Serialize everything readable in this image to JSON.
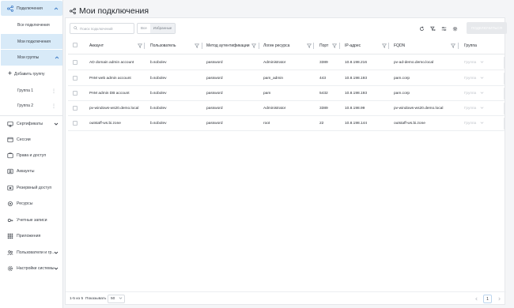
{
  "sidebar": {
    "connections_label": "Подключения",
    "all_connections": "Все подключения",
    "my_connections": "Мои подключения",
    "my_groups": "Мои группы",
    "add_group": "Добавить группу",
    "groups": [
      {
        "label": "Группа 1"
      },
      {
        "label": "Группа 2"
      }
    ],
    "items": [
      {
        "label": "Сертификаты",
        "icon": "certificate-icon",
        "has_chevron": true
      },
      {
        "label": "Сессии",
        "icon": "sessions-icon",
        "has_chevron": false
      },
      {
        "label": "Права и доступ",
        "icon": "rights-icon",
        "has_chevron": false
      },
      {
        "label": "Аккаунты",
        "icon": "accounts-icon",
        "has_chevron": false
      },
      {
        "label": "Резервный доступ",
        "icon": "backup-access-icon",
        "has_chevron": false
      },
      {
        "label": "Ресурсы",
        "icon": "resources-icon",
        "has_chevron": false
      },
      {
        "label": "Учетные записи",
        "icon": "credentials-icon",
        "has_chevron": false
      },
      {
        "label": "Приложения",
        "icon": "apps-icon",
        "has_chevron": false
      },
      {
        "label": "Пользователи и гр...",
        "icon": "users-icon",
        "has_chevron": true
      },
      {
        "label": "Настройки системы",
        "icon": "system-settings-icon",
        "has_chevron": true
      }
    ]
  },
  "header": {
    "title": "Мои подключения"
  },
  "toolbar": {
    "search_placeholder": "Поиск подключений",
    "filter_all": "Все",
    "filter_favorites": "Избранные",
    "create_label": "ПОДКЛЮЧИТЬСЯ"
  },
  "table": {
    "columns": [
      "Аккаунт",
      "Пользователь",
      "Метод аутентификации",
      "Логин ресурса",
      "Порт",
      "IP-адрес",
      "FQDN",
      "Группа"
    ],
    "rows": [
      {
        "account": "AD domain admin account",
        "user": "b.sobolev",
        "auth": "password",
        "login": "Administrator",
        "port": "3389",
        "ip": "10.8.198.216",
        "fqdn": "pv-ad-demo.demo.local",
        "group": "Группа"
      },
      {
        "account": "PAM web admin account",
        "user": "b.sobolev",
        "auth": "password",
        "login": "pam_admin",
        "port": "443",
        "ip": "10.8.198.193",
        "fqdn": "pam.corp",
        "group": "Группа"
      },
      {
        "account": "PAM admin DB account",
        "user": "b.sobolev",
        "auth": "password",
        "login": "pam",
        "port": "5432",
        "ip": "10.8.198.193",
        "fqdn": "pam.corp",
        "group": "Группа"
      },
      {
        "account": "pv-windows-ws20.demo.local",
        "user": "b.sobolev",
        "auth": "password",
        "login": "Administrator",
        "port": "3389",
        "ip": "10.8.198.99",
        "fqdn": "pv-windows-ws20.demo.local",
        "group": "Группа"
      },
      {
        "account": "outstaff-ws.bi.zone",
        "user": "b.sobolev",
        "auth": "password",
        "login": "root",
        "port": "22",
        "ip": "10.8.198.144",
        "fqdn": "outstaff-ws.bi.zone",
        "group": "Группа"
      }
    ]
  },
  "footer": {
    "range": "1-5 из 5",
    "show_label": "Показывать",
    "page_size": "50",
    "current_page": "1"
  },
  "colors": {
    "accent_bg": "#d8eaf8",
    "panel_border": "#e6e8eb",
    "muted_text": "#a3a9b1"
  }
}
